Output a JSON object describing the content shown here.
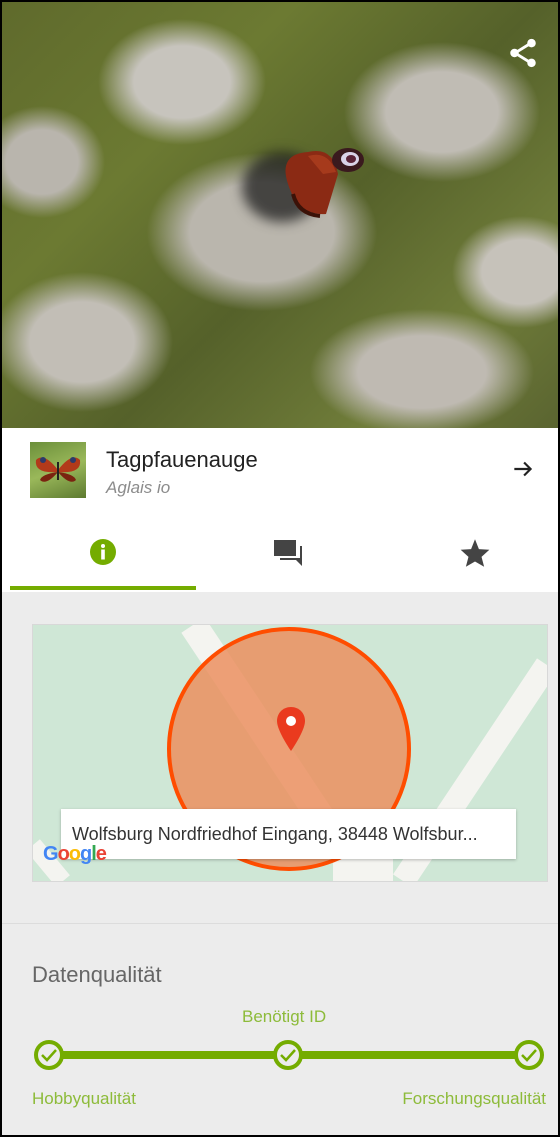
{
  "species": {
    "common_name": "Tagpfauenauge",
    "scientific_name": "Aglais io"
  },
  "tabs": [
    {
      "name": "info",
      "icon": "info-icon",
      "active": true
    },
    {
      "name": "comments",
      "icon": "chat-icon",
      "active": false
    },
    {
      "name": "favorite",
      "icon": "star-icon",
      "active": false
    }
  ],
  "map": {
    "address": "Wolfsburg Nordfriedhof Eingang, 38448 Wolfsbur...",
    "attribution": "Google"
  },
  "data_quality": {
    "title": "Datenqualität",
    "middle_label": "Benötigt ID",
    "left_label": "Hobbyqualität",
    "right_label": "Forschungsqualität",
    "steps_completed": 3,
    "steps_total": 3
  },
  "colors": {
    "accent_green": "#74ac00",
    "label_green": "#8dbb3a",
    "radius_orange": "#ff4d00"
  }
}
